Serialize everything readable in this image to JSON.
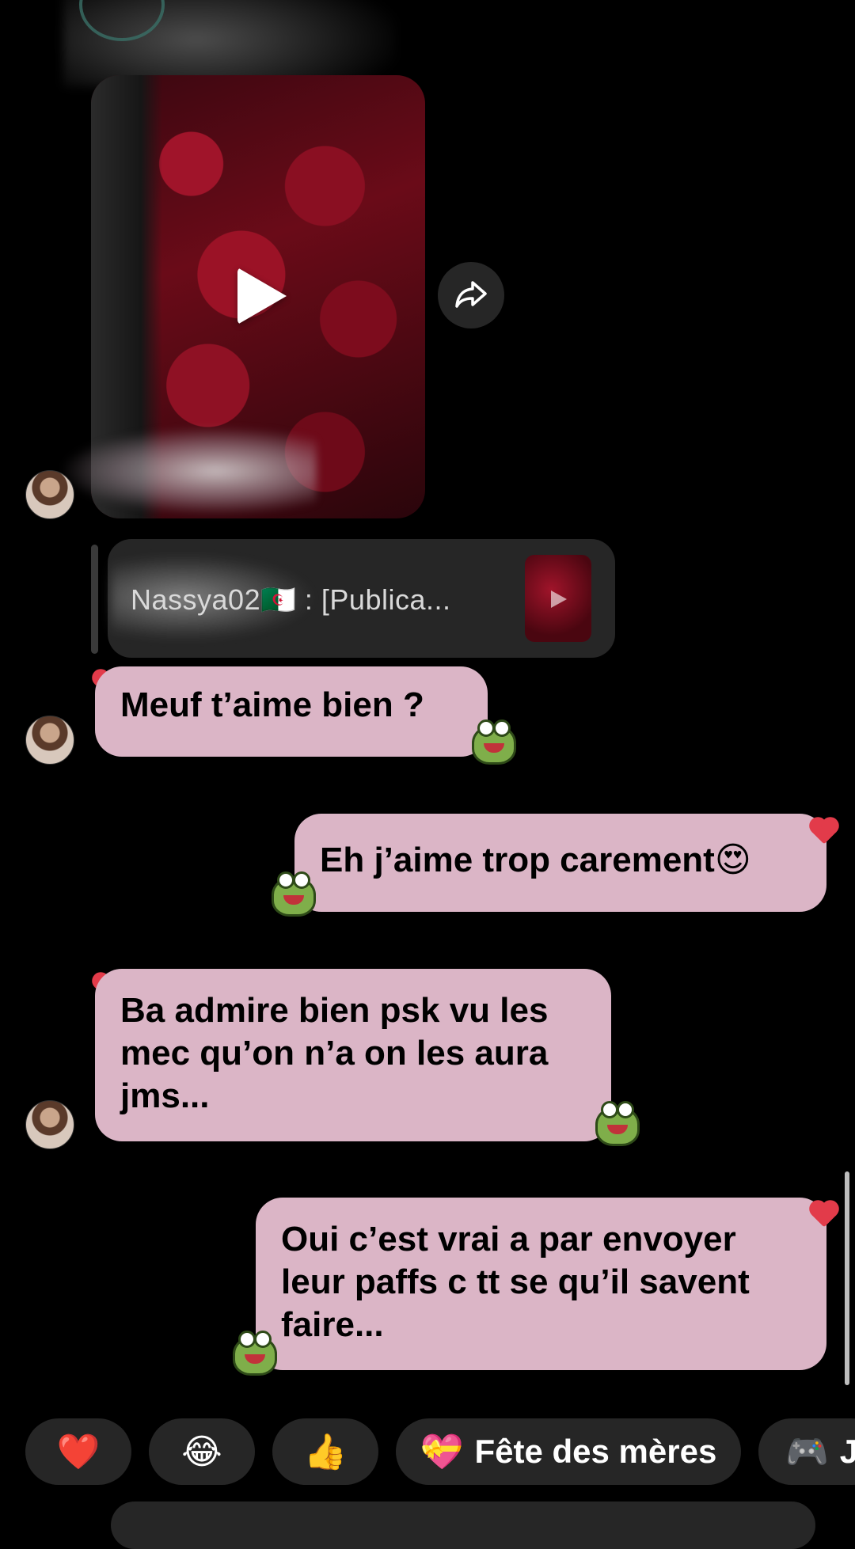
{
  "header": {
    "avatar_icon": "avatar-image"
  },
  "shared_post": {
    "type": "video",
    "play_icon": "play-icon",
    "share_icon": "share-arrow-icon"
  },
  "reply_quote": {
    "text": "Nassya02🇩🇿 : [Publica..."
  },
  "messages": [
    {
      "side": "left",
      "text": "Meuf t’aime bien ?",
      "reaction": "frog-sticker-icon",
      "liked": true
    },
    {
      "side": "right",
      "text": "Eh j’aime trop carement😍",
      "reaction": "frog-sticker-icon",
      "liked": true
    },
    {
      "side": "left",
      "lines": [
        "Ba admire bien psk vu les",
        "mec qu’on n’a on les aura",
        "jms..."
      ],
      "reaction": "frog-sticker-icon",
      "liked": true
    },
    {
      "side": "right",
      "lines": [
        "Oui c’est vrai a par envoyer",
        "leur paffs c tt se qu’il savent",
        "faire..."
      ],
      "reaction": "frog-sticker-icon",
      "liked": true
    }
  ],
  "quick_replies": [
    {
      "emoji": "❤️",
      "icon": "heart-icon"
    },
    {
      "emoji": "😂",
      "icon": "laughing-emoji-icon"
    },
    {
      "emoji": "👍",
      "icon": "thumbs-up-icon"
    },
    {
      "emoji": "💝",
      "label": "Fête des mères",
      "icon": "gift-heart-icon"
    },
    {
      "emoji": "🎮",
      "label": "J",
      "icon": "gamepad-icon"
    }
  ],
  "colors": {
    "background": "#000000",
    "bubble": "#dbb5c6",
    "pill": "#262626",
    "heart": "#e23b4a"
  }
}
